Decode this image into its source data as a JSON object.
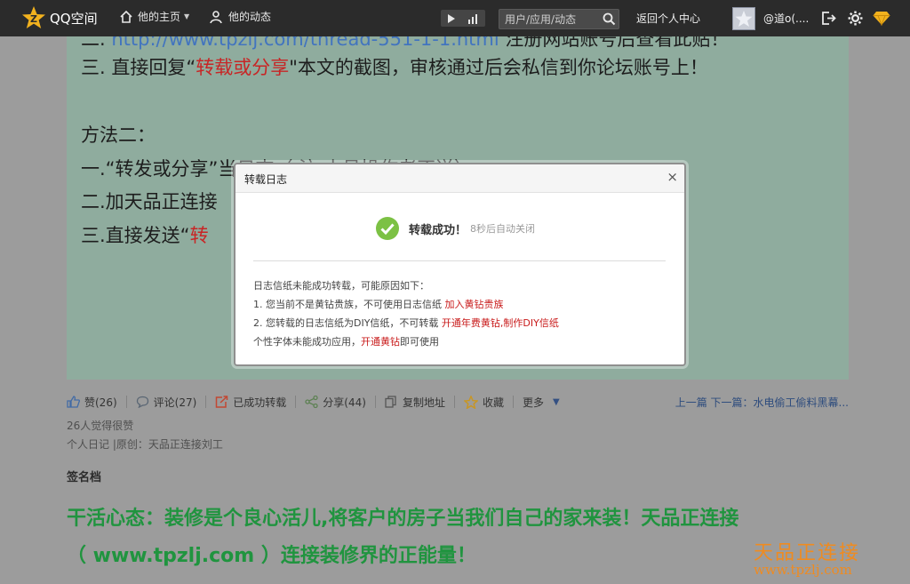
{
  "topbar": {
    "logo_text": "QQ空间",
    "nav_home": "他的主页",
    "nav_feed": "他的动态",
    "search_placeholder": "用户/应用/动态",
    "return_label": "返回个人中心",
    "username": "@道o(...."
  },
  "article": {
    "line1_prefix": "二. ",
    "line1_link": "http://www.tpzlj.com/thread-551-1-1.html",
    "line1_suffix": " 注册网站账号后查看此贴！",
    "line2_a": "三. 直接回复“",
    "line2_red": "转载或分享",
    "line2_b": "\"本文的截图，审核通过后会私信到你论坛账号上！",
    "method_two": "方法二：",
    "m2_line1": " 一.“转发或分享”当日志（ 注:小号操作者不送）",
    "m2_line2": "二.加天品正连接",
    "m2_line3_a": "三.直接发送“",
    "m2_line3_red": "转"
  },
  "actions": {
    "like": "赞(26)",
    "comment": "评论(27)",
    "reposted": "已成功转载",
    "share": "分享(44)",
    "copy": "复制地址",
    "favorite": "收藏",
    "more": "更多",
    "prev_next": "上一篇 下一篇：水电偷工偷料黑幕..."
  },
  "meta": {
    "likes_text": "26人觉得很赞",
    "category": "个人日记 |原创：天品正连接刘工"
  },
  "signature": {
    "title": "签名档",
    "line1": "干活心态：装修是个良心活儿,将客户的房子当我们自己的家来装！天品正连接",
    "line2": "（ www.tpzlj.com ）连接装修界的正能量！"
  },
  "watermark": {
    "brand": "天品正连接",
    "url": "www.tpzlj.com"
  },
  "dialog": {
    "title": "转载日志",
    "close": "×",
    "success": "转载成功！",
    "auto_close": "8秒后自动关闭",
    "reason_intro": "日志信纸未能成功转载，可能原因如下：",
    "reason1": "1. 您当前不是黄钻贵族，不可使用日志信纸 ",
    "reason1_link": "加入黄钻贵族",
    "reason2": "2. 您转载的日志信纸为DIY信纸，不可转载 ",
    "reason2_link": "开通年费黄钻,制作DIY信纸",
    "reason3_a": "个性字体未能成功应用，",
    "reason3_link": "开通黄钻",
    "reason3_b": "即可使用"
  },
  "colors": {
    "topbar_bg": "#2b2b2b",
    "article_bg": "#9bbfae",
    "red_text": "#e11a1a",
    "green_text": "#14a23a",
    "watermark": "#ef8b20",
    "success_green": "#7cc144"
  }
}
